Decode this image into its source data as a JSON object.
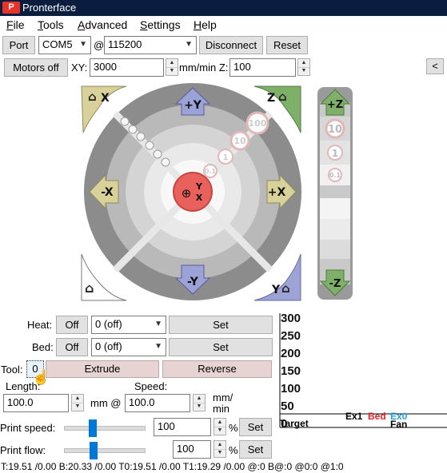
{
  "window": {
    "logo": "P",
    "title": "Pronterface"
  },
  "menu": [
    {
      "key": "F",
      "rest": "ile"
    },
    {
      "key": "T",
      "rest": "ools"
    },
    {
      "key": "A",
      "rest": "dvanced"
    },
    {
      "key": "S",
      "rest": "ettings"
    },
    {
      "key": "H",
      "rest": "elp"
    }
  ],
  "connection": {
    "port_label": "Port",
    "port_value": "COM5",
    "at": "@",
    "baud_value": "115200",
    "disconnect_label": "Disconnect",
    "reset_label": "Reset"
  },
  "motion": {
    "motors_off_label": "Motors off",
    "xy_label": "XY:",
    "xy_value": "3000",
    "units_label": "mm/min Z:",
    "z_value": "100",
    "collapse_label": "<"
  },
  "jog": {
    "home_x": "X",
    "home_z": "Z",
    "plus_y": "+Y",
    "minus_y": "-Y",
    "minus_x": "-X",
    "plus_x": "+X",
    "home_y": "Y",
    "center_y": "Y",
    "center_x": "X",
    "steps": [
      "100",
      "10",
      "1",
      "0.1"
    ],
    "z_plus": "+Z",
    "z_minus": "-Z",
    "z_steps": [
      "10",
      "1",
      "0.1"
    ]
  },
  "temps": {
    "heat_label": "Heat:",
    "bed_label": "Bed:",
    "off_label": "Off",
    "heat_value": "0 (off)",
    "bed_value": "0 (off)",
    "set_label": "Set"
  },
  "extrude": {
    "tool_label": "Tool:",
    "tool_value": "0",
    "extrude_label": "Extrude",
    "reverse_label": "Reverse",
    "length_label": "Length:",
    "speed_label": "Speed:",
    "length_value": "100.0",
    "mm_at": "mm @",
    "speed_value": "100.0",
    "speed_units": "mm/\nmin"
  },
  "print": {
    "speed_label": "Print speed:",
    "speed_value": "100",
    "flow_label": "Print flow:",
    "flow_value": "100",
    "percent": "%",
    "set_label": "Set",
    "speed_fraction": 0.35,
    "flow_fraction": 0.36
  },
  "graph": {
    "y_ticks": [
      "300",
      "250",
      "200",
      "150",
      "100",
      "50",
      "0"
    ],
    "legend": [
      {
        "label": "Target",
        "color": "#000000"
      },
      {
        "label": "Ex1",
        "color": "#000000"
      },
      {
        "label": "Bed",
        "color": "#e3242b"
      },
      {
        "label": "Ex0",
        "color": "#2aa0e0"
      },
      {
        "label": "Fan",
        "color": "#000000"
      }
    ]
  },
  "status": {
    "text": "T:19.51 /0.00 B:20.33 /0.00 T0:19.51 /0.00 T1:19.29 /0.00 @:0 B@:0 @0:0 @1:0"
  },
  "colors": {
    "home_x_bg": "#d8d29a",
    "home_z_bg": "#7fb06a",
    "y_arrow": "#9aa2d8",
    "x_arrow": "#d8d29a",
    "z_arrow": "#7fb06a",
    "center": "#e8615c",
    "home_y_bg": "#9ea3d6"
  }
}
